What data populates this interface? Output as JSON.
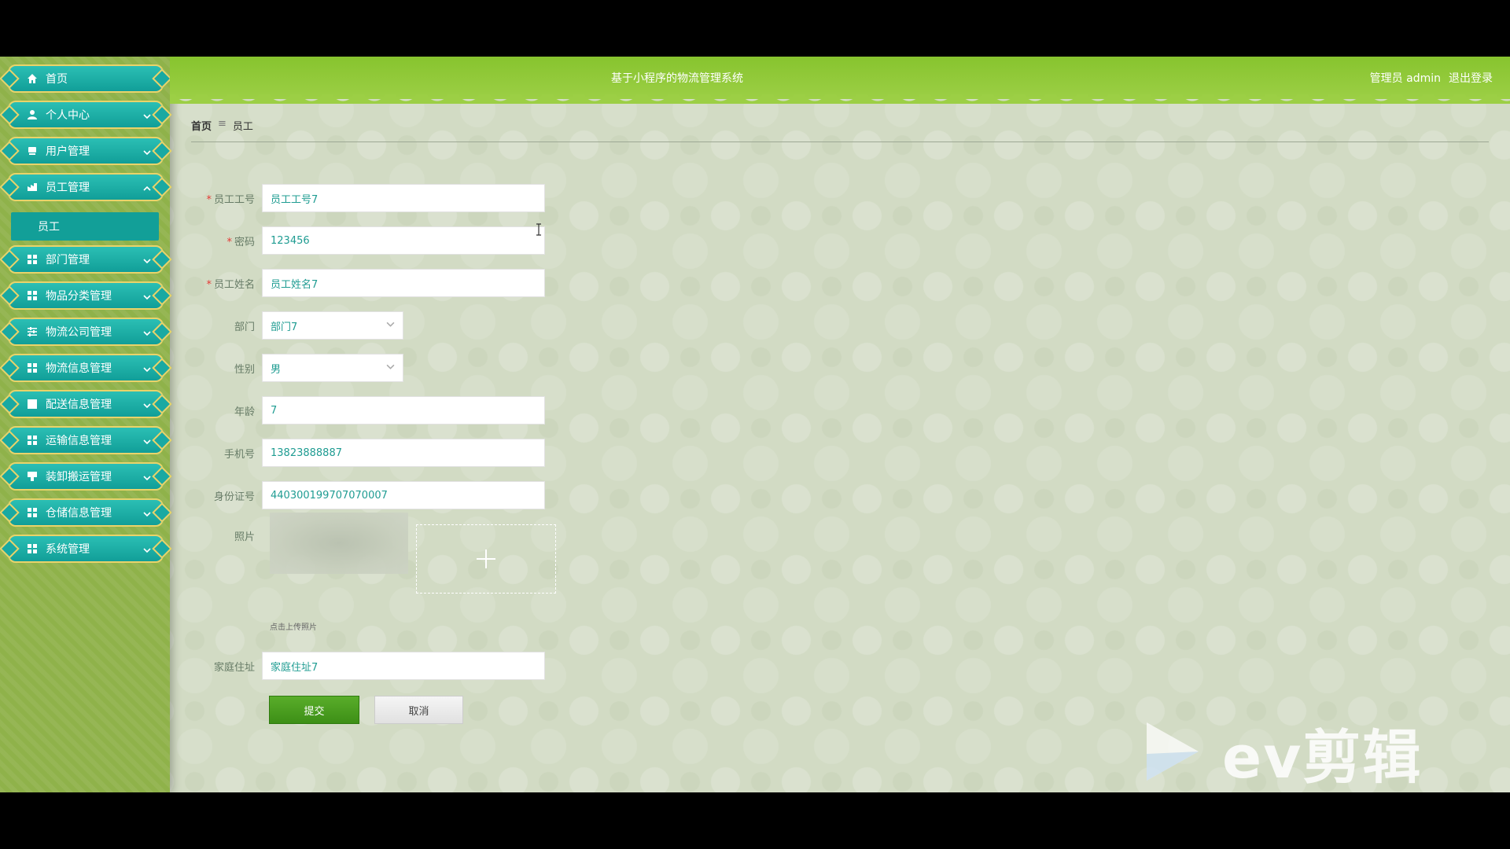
{
  "header": {
    "title": "基于小程序的物流管理系统",
    "user_label": "管理员 admin",
    "logout_label": "退出登录"
  },
  "sidebar": {
    "items": [
      {
        "label": "首页",
        "icon": "home-icon"
      },
      {
        "label": "个人中心",
        "icon": "user-icon"
      },
      {
        "label": "用户管理",
        "icon": "users-icon"
      },
      {
        "label": "员工管理",
        "icon": "staff-icon"
      },
      {
        "label": "部门管理",
        "icon": "grid-icon"
      },
      {
        "label": "物品分类管理",
        "icon": "grid-icon"
      },
      {
        "label": "物流公司管理",
        "icon": "sliders-icon"
      },
      {
        "label": "物流信息管理",
        "icon": "grid-icon"
      },
      {
        "label": "配送信息管理",
        "icon": "chart-icon"
      },
      {
        "label": "运输信息管理",
        "icon": "grid-icon"
      },
      {
        "label": "装卸搬运管理",
        "icon": "truck-icon"
      },
      {
        "label": "仓储信息管理",
        "icon": "grid-icon"
      },
      {
        "label": "系统管理",
        "icon": "grid-icon"
      }
    ],
    "sub_item": "员工"
  },
  "breadcrumb": {
    "home": "首页",
    "separator": "≡",
    "current": "员工"
  },
  "form": {
    "employee_id": {
      "label": "员工工号",
      "value": "员工工号7"
    },
    "password": {
      "label": "密码",
      "value": "123456"
    },
    "name": {
      "label": "员工姓名",
      "value": "员工姓名7"
    },
    "department": {
      "label": "部门",
      "value": "部门7"
    },
    "gender": {
      "label": "性别",
      "value": "男"
    },
    "age": {
      "label": "年龄",
      "value": "7"
    },
    "phone": {
      "label": "手机号",
      "value": "13823888887"
    },
    "id_card": {
      "label": "身份证号",
      "value": "440300199707070007"
    },
    "photo": {
      "label": "照片",
      "hint": "点击上传照片"
    },
    "address": {
      "label": "家庭住址",
      "value": "家庭住址7"
    },
    "submit_label": "提交",
    "cancel_label": "取消",
    "required_mark": "*"
  },
  "watermark": {
    "text": "ev剪辑"
  },
  "colors": {
    "header": "#8cc63a",
    "nav": "#1aa9a2",
    "nav_border": "#e9d36a",
    "submit": "#4a9e20"
  }
}
